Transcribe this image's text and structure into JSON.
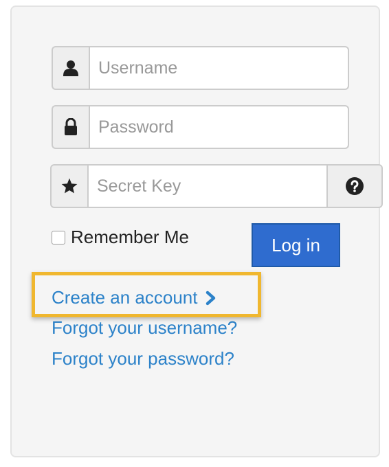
{
  "form": {
    "username": {
      "placeholder": "Username",
      "value": ""
    },
    "password": {
      "placeholder": "Password",
      "value": ""
    },
    "secret_key": {
      "placeholder": "Secret Key",
      "value": ""
    },
    "remember_label": "Remember Me",
    "remember_checked": false,
    "login_label": "Log in"
  },
  "links": {
    "create_account": "Create an account",
    "forgot_username": "Forgot your username?",
    "forgot_password": "Forgot your password?"
  },
  "icons": {
    "username": "user-icon",
    "password": "lock-icon",
    "secret_key": "star-icon",
    "help": "question-circle-icon",
    "create_arrow": "chevron-right-icon"
  },
  "colors": {
    "link": "#2c82c9",
    "button": "#2f6ccf",
    "highlight": "#f0b72f",
    "panel_bg": "#f5f5f5"
  }
}
